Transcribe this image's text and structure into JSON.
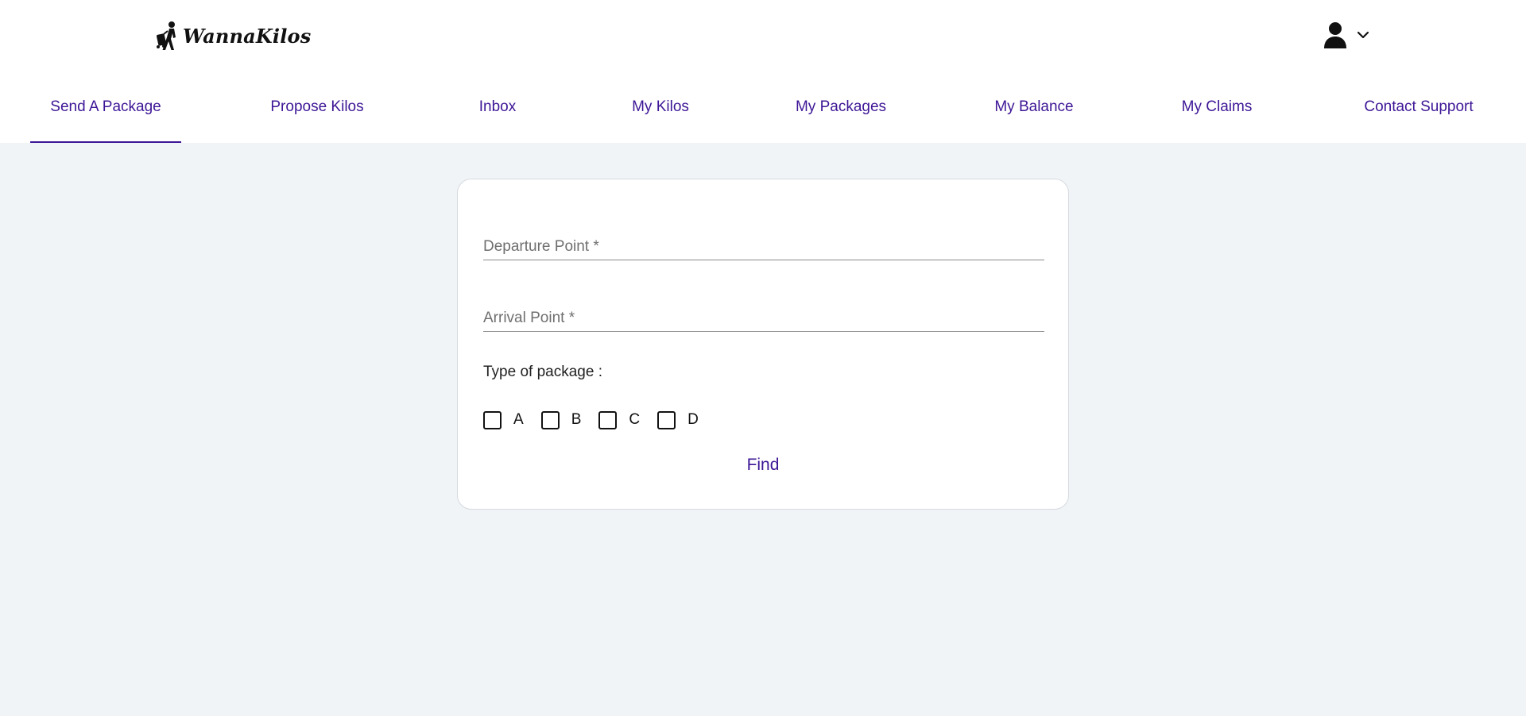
{
  "brand": {
    "name": "WannaKilos",
    "logo_icon": "traveler-with-luggage-icon"
  },
  "header": {
    "user_icon": "user-icon",
    "menu_icon": "chevron-down-icon"
  },
  "nav": {
    "items": [
      {
        "label": "Send A Package",
        "active": true
      },
      {
        "label": "Propose Kilos",
        "active": false
      },
      {
        "label": "Inbox",
        "active": false
      },
      {
        "label": "My Kilos",
        "active": false
      },
      {
        "label": "My Packages",
        "active": false
      },
      {
        "label": "My Balance",
        "active": false
      },
      {
        "label": "My Claims",
        "active": false
      },
      {
        "label": "Contact Support",
        "active": false
      }
    ]
  },
  "form": {
    "departure": {
      "placeholder": "Departure Point *",
      "value": ""
    },
    "arrival": {
      "placeholder": "Arrival Point *",
      "value": ""
    },
    "package_type_label": "Type of package :",
    "package_types": [
      {
        "label": "A",
        "checked": false
      },
      {
        "label": "B",
        "checked": false
      },
      {
        "label": "C",
        "checked": false
      },
      {
        "label": "D",
        "checked": false
      }
    ],
    "submit_label": "Find"
  },
  "colors": {
    "accent": "#3d1696",
    "page_background": "#f1f4f7",
    "surface": "#ffffff"
  }
}
